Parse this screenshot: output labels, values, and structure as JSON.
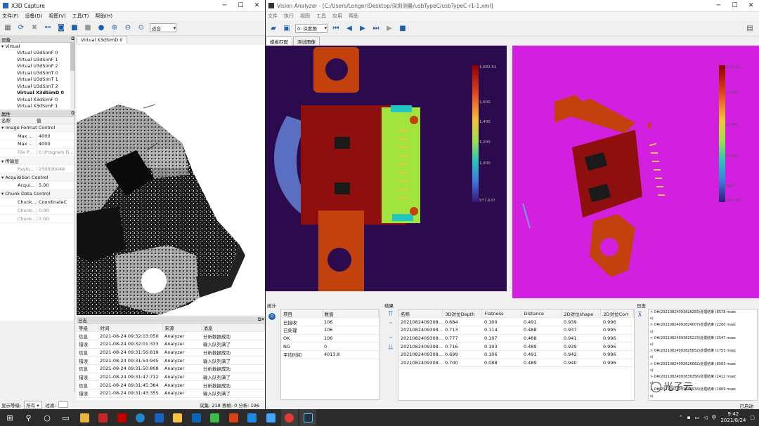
{
  "capture": {
    "title": "X3D Capture",
    "menu": [
      "文件(F)",
      "设备(D)",
      "视图(V)",
      "工具(T)",
      "帮助(H)"
    ],
    "toolbar_select": "适合",
    "devices_header": "设备",
    "device_root": "Virtual",
    "devices": [
      "Virtual U3dSimF 0",
      "Virtual U3dSimF 1",
      "Virtual U3dSimF 2",
      "Virtual U3dSimT 0",
      "Virtual U3dSimT 1",
      "Virtual U3dSimT 2",
      "Virtual X3dSimD 0",
      "Virtual X3dSimF 0",
      "Virtual X3dSimF 1"
    ],
    "properties_header": "属性",
    "prop_col_name": "名称",
    "prop_col_value": "值",
    "props": [
      {
        "indent": 0,
        "name": "Image Format Control",
        "value": "",
        "group": true
      },
      {
        "indent": 1,
        "name": "Max ...",
        "value": "4000"
      },
      {
        "indent": 1,
        "name": "Max ...",
        "value": "4000"
      },
      {
        "indent": 1,
        "name": "File P...",
        "value": "C:\\Program Fi...",
        "dim": true
      },
      {
        "indent": 0,
        "name": "传输层",
        "value": "",
        "group": true
      },
      {
        "indent": 1,
        "name": "Paylo...",
        "value": "250000048",
        "dim": true
      },
      {
        "indent": 0,
        "name": "Acquisition Control",
        "value": "",
        "group": true
      },
      {
        "indent": 1,
        "name": "Acqui...",
        "value": "5.00"
      },
      {
        "indent": 0,
        "name": "Chunk Data Control",
        "value": "",
        "group": true
      },
      {
        "indent": 1,
        "name": "Chunk...",
        "value": "CoordinateC"
      },
      {
        "indent": 1,
        "name": "Chunk...",
        "value": "0.00",
        "dim": true
      },
      {
        "indent": 1,
        "name": "Chunk...",
        "value": "0.00",
        "dim": true
      }
    ],
    "view_tab": "Virtual X3dSimD 0",
    "log_header": "日志",
    "log_cols": [
      "等级",
      "时间",
      "来源",
      "消息"
    ],
    "log_rows": [
      [
        "信息",
        "2021-08-24 09:32:03:050",
        "Analyzer",
        "分析数据成功"
      ],
      [
        "错误",
        "2021-08-24 09:32:01:333",
        "Analyzer",
        "输入队列满了"
      ],
      [
        "信息",
        "2021-08-24 09:31:56:819",
        "Analyzer",
        "分析数据成功"
      ],
      [
        "错误",
        "2021-08-24 09:31:54:945",
        "Analyzer",
        "输入队列满了"
      ],
      [
        "信息",
        "2021-08-24 09:31:50:808",
        "Analyzer",
        "分析数据成功"
      ],
      [
        "错误",
        "2021-08-24 09:31:47:712",
        "Analyzer",
        "输入队列满了"
      ],
      [
        "信息",
        "2021-08-24 09:31:45:384",
        "Analyzer",
        "分析数据成功"
      ],
      [
        "错误",
        "2021-08-24 09:31:43:355",
        "Analyzer",
        "输入队列满了"
      ]
    ],
    "status_left_label": "显示等级:",
    "status_level": "所有",
    "status_filter_label": "过滤:",
    "status_right": "采集: 218  丢帧: 0  分析: 196"
  },
  "analyzer": {
    "title": "Vision Analyzer - [C:/Users/Longer/Desktop/深圳测量/usbTypeC/usbTypeC-r1-1.xml]",
    "menu": [
      "文件",
      "执行",
      "视图",
      "工具",
      "应用",
      "帮助"
    ],
    "view_select": "0: 深度图",
    "tabs": [
      "模板匹配",
      "测试图像"
    ],
    "colorbar_left": {
      "max": "1,682.51",
      "ticks": [
        "1,600",
        "1,400",
        "1,200",
        "1,000"
      ],
      "min": "877.637"
    },
    "colorbar_right": {
      "max": "672.51",
      "ticks": [
        "1,400",
        "1,200",
        "1,000",
        "900"
      ],
      "min": "247.39"
    },
    "stats_header": "统计",
    "stats_cols": [
      "项目",
      "数值"
    ],
    "stats_rows": [
      [
        "已接收",
        "106"
      ],
      [
        "已处理",
        "106"
      ],
      [
        "OK",
        "106"
      ],
      [
        "NG",
        "0"
      ],
      [
        "平均时间",
        "4013.8"
      ]
    ],
    "results_header": "结果",
    "result_cols": [
      "名称",
      "3D对位Depth",
      "Flatness",
      "Distance",
      "2D对位shape",
      "2D对位Corr"
    ],
    "result_rows": [
      [
        "2021082409308...",
        "0.684",
        "0.100",
        "0.491",
        "0.939",
        "0.996"
      ],
      [
        "2021082409308...",
        "0.713",
        "0.114",
        "0.488",
        "0.937",
        "0.995"
      ],
      [
        "2021082409308...",
        "0.777",
        "0.107",
        "0.488",
        "0.941",
        "0.996"
      ],
      [
        "2021082409308...",
        "0.716",
        "0.103",
        "0.489",
        "0.939",
        "0.996"
      ],
      [
        "2021082409308...",
        "0.699",
        "0.106",
        "0.491",
        "0.942",
        "0.996"
      ],
      [
        "2021082409308...",
        "0.700",
        "0.088",
        "0.489",
        "0.940",
        "0.996"
      ]
    ],
    "log_header": "日志",
    "log_lines": [
      "> 0#(20210824093828283)处理结束 (8578 msec",
      "s)",
      "> 0#(20210824093824007)处理结束 (2200 msec",
      "s)",
      "> 0#(20210824093825223)处理结束 (2547 msec",
      "s)",
      "> 0#(20210824093825652)处理结束 (1753 msec",
      "s)",
      "> 0#(20210824093826682)处理结束 (8563 msec",
      "s)",
      "> 0#(20210824093836356)处理结束 (2412 msec",
      "s)",
      "> 0#(20210824093838934)处理结束 (1809 msec",
      "s)",
      "> 0#(20210824093839342)处理结束 (8345 msec"
    ],
    "status": "已启动",
    "watermark": "光子云"
  },
  "taskbar": {
    "time": "9:42",
    "date": "2021/8/24"
  }
}
